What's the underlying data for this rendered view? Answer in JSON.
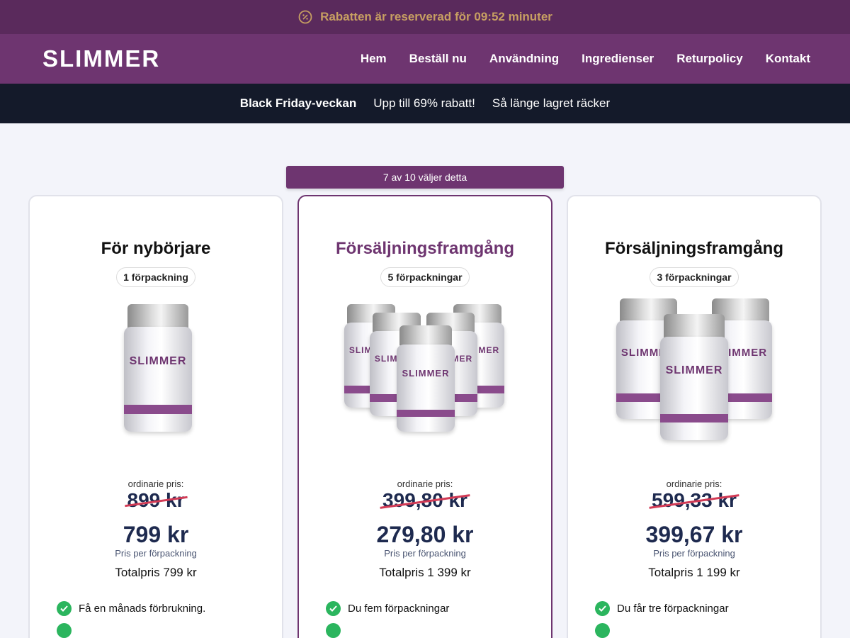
{
  "topbar": {
    "message": "Rabatten är reserverad för 09:52 minuter",
    "icon": "clock-icon",
    "color": "#c79f62"
  },
  "header": {
    "logo": "SLIMMER",
    "nav": [
      "Hem",
      "Beställ nu",
      "Användning",
      "Ingredienser",
      "Returpolicy",
      "Kontakt"
    ]
  },
  "promo": {
    "part1": "Black Friday-veckan",
    "part2": "Upp till 69% rabatt!",
    "part3": "Så länge lagret räcker"
  },
  "popular_label": "7 av 10 väljer detta",
  "product_brand": "SLIMMER",
  "cards": [
    {
      "title": "För nybörjare",
      "badge": "1 förpackning",
      "ordinary_label": "ordinarie pris:",
      "old_price": "899 kr",
      "new_price": "799 kr",
      "per_label": "Pris per förpackning",
      "total": "Totalpris 799 kr",
      "features": [
        "Få en månads förbrukning.",
        ""
      ]
    },
    {
      "title": "Försäljningsframgång",
      "badge": "5 förpackningar",
      "ordinary_label": "ordinarie pris:",
      "old_price": "399,80 kr",
      "new_price": "279,80 kr",
      "per_label": "Pris per förpackning",
      "total": "Totalpris 1 399 kr",
      "features": [
        "Du fem förpackningar",
        ""
      ]
    },
    {
      "title": "Försäljningsframgång",
      "badge": "3 förpackningar",
      "ordinary_label": "ordinarie pris:",
      "old_price": "599,33 kr",
      "new_price": "399,67 kr",
      "per_label": "Pris per förpackning",
      "total": "Totalpris 1 199 kr",
      "features": [
        "Du får tre förpackningar",
        ""
      ]
    }
  ],
  "colors": {
    "brand_purple": "#6e3570",
    "price_navy": "#1e2a4f",
    "strike_red": "#d23a55",
    "check_green": "#2bb55e"
  }
}
